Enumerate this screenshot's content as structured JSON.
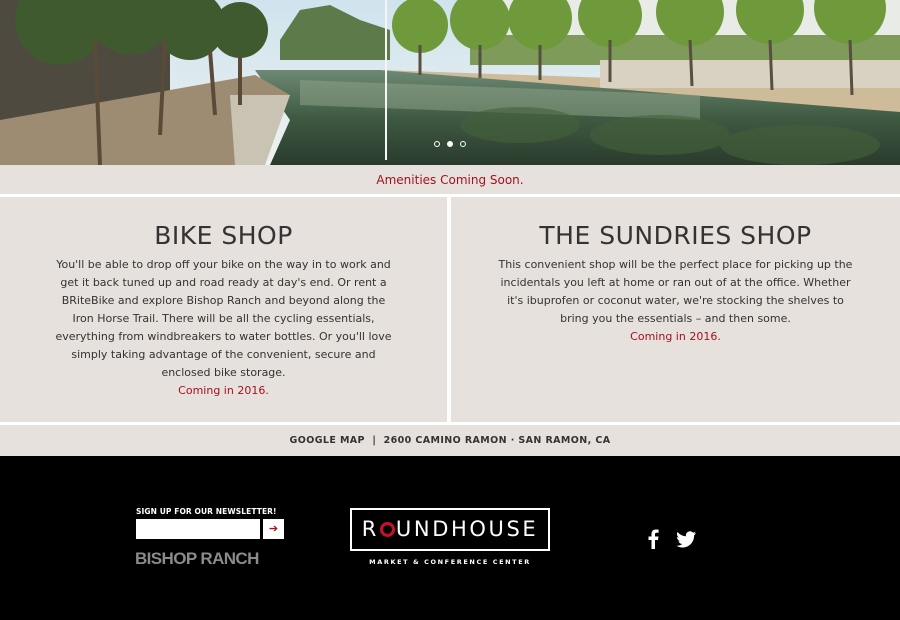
{
  "hero": {
    "slides_count": 3,
    "active_slide": 2
  },
  "notice": {
    "text": "Amenities Coming Soon."
  },
  "bike_shop": {
    "title": "BIKE SHOP",
    "description": "You'll be able to drop off your bike on the way in to work and get it back tuned up and road ready at day's end. Or rent a BRiteBike and explore Bishop Ranch and beyond along the Iron Horse Trail. There will be all the cycling essentials, everything from windbreakers to water bottles. Or you'll love simply taking advantage of the convenient, secure and enclosed bike storage.",
    "coming": "Coming in 2016."
  },
  "sundries_shop": {
    "title": "THE SUNDRIES SHOP",
    "description": "This convenient shop will be the perfect place for picking up the incidentals you left at home or ran out of at the office. Whether it's ibuprofen or coconut water, we're stocking the shelves to bring you the essentials – and then some.",
    "coming": "Coming in 2016."
  },
  "address_bar": {
    "map_link": "GOOGLE MAP",
    "separator": "|",
    "address": "2600 CAMINO RAMON · SAN RAMON, CA"
  },
  "footer": {
    "newsletter_label": "SIGN UP FOR OUR NEWSLETTER!",
    "newsletter_value": "",
    "submit_glyph": "➔",
    "bishop_ranch_logo": "BISHOP RANCH",
    "roundhouse_logo": {
      "before": "R",
      "after": "UNDHOUSE"
    },
    "roundhouse_subtitle": "MARKET & CONFERENCE CENTER",
    "social": [
      "facebook-icon",
      "twitter-icon"
    ]
  },
  "colors": {
    "accent": "#a3121f",
    "logo_ring": "#c8102e",
    "panel_bg": "#e6e1dc",
    "footer_bg": "#000000"
  }
}
